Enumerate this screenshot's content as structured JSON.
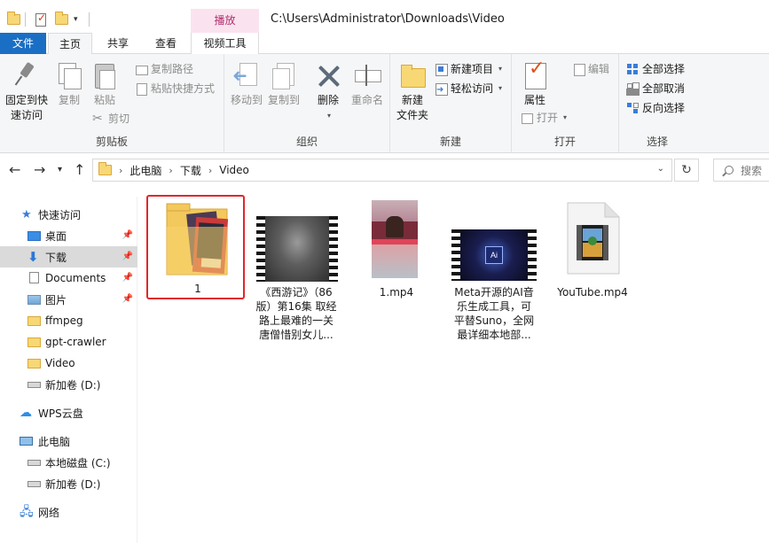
{
  "window": {
    "path_title": "C:\\Users\\Administrator\\Downloads\\Video",
    "context_tab_top": "播放",
    "context_tab": "视频工具"
  },
  "tabs": [
    "文件",
    "主页",
    "共享",
    "查看"
  ],
  "ribbon": {
    "clipboard": {
      "label": "剪贴板",
      "pin_quick_access": "固定到快速访问",
      "pin_quick_access_l1": "固定到快",
      "pin_quick_access_l2": "速访问",
      "copy": "复制",
      "paste": "粘贴",
      "copy_path": "复制路径",
      "paste_shortcut": "粘贴快捷方式",
      "cut": "剪切"
    },
    "organize": {
      "label": "组织",
      "move_to": "移动到",
      "copy_to": "复制到",
      "delete": "删除",
      "rename": "重命名"
    },
    "new": {
      "label": "新建",
      "new_folder_l1": "新建",
      "new_folder_l2": "文件夹",
      "new_item": "新建项目",
      "easy_access": "轻松访问"
    },
    "open": {
      "label": "打开",
      "properties": "属性",
      "open": "打开",
      "edit": "编辑"
    },
    "select": {
      "label": "选择",
      "select_all": "全部选择",
      "select_none": "全部取消",
      "invert": "反向选择"
    }
  },
  "address": {
    "crumbs": [
      "此电脑",
      "下载",
      "Video"
    ],
    "search_placeholder": "搜索"
  },
  "nav": {
    "quick_access": "快速访问",
    "desktop": "桌面",
    "downloads": "下载",
    "documents": "Documents",
    "pictures": "图片",
    "ffmpeg": "ffmpeg",
    "gpt_crawler": "gpt-crawler",
    "video": "Video",
    "new_volume_d": "新加卷 (D:)",
    "wps_cloud": "WPS云盘",
    "this_pc": "此电脑",
    "local_disk_c": "本地磁盘 (C:)",
    "new_volume_d2": "新加卷 (D:)",
    "network": "网络"
  },
  "files": [
    {
      "name": "1",
      "lines": [
        "1"
      ],
      "type": "folder"
    },
    {
      "name": "《西游记》（86版）第16集 取经路上最难的一关 唐僧惜别女儿...",
      "lines": [
        "《西游记》（86",
        "版）第16集 取经",
        "路上最难的一关",
        "唐僧惜别女儿..."
      ],
      "type": "video"
    },
    {
      "name": "1.mp4",
      "lines": [
        "1.mp4"
      ],
      "type": "video"
    },
    {
      "name": "Meta开源的AI音乐生成工具，可平替Suno，全网最详细本地部...",
      "lines": [
        "Meta开源的AI音",
        "乐生成工具，可",
        "平替Suno，全网",
        "最详细本地部..."
      ],
      "type": "video"
    },
    {
      "name": "YouTube.mp4",
      "lines": [
        "YouTube.mp4"
      ],
      "type": "video"
    }
  ],
  "thumb_text": {
    "ai_badge": "Ai"
  }
}
